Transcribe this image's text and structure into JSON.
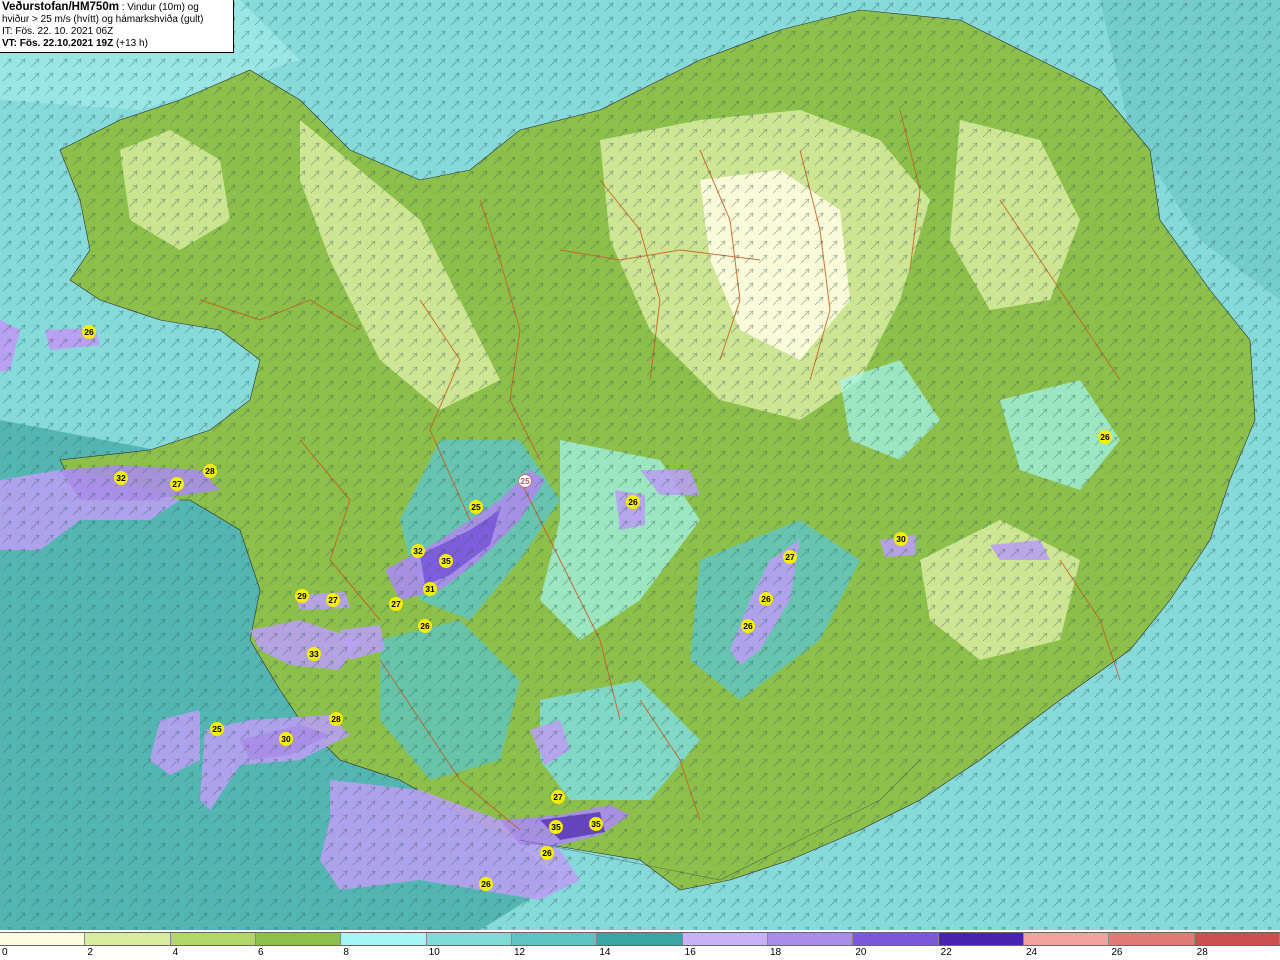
{
  "header": {
    "title": "Veðurstofan/HM750m",
    "desc_1": " : Vindur (10m) og",
    "desc_2": "hviður > 25 m/s (hvítt) og hámarkshviða (gult)",
    "issue_time": "IT: Fös. 22. 10. 2021 06Z",
    "valid_time_label": "VT: Fös. 22.10.2021 19Z",
    "valid_time_offset": " (+13 h)"
  },
  "legend": {
    "colors": [
      "#fffde0",
      "#d9eca0",
      "#b3d66b",
      "#8dc04a",
      "#a2f7f5",
      "#7fdcd9",
      "#5fc4c1",
      "#3aa5a3",
      "#c7b2f5",
      "#a98de8",
      "#7a58d8",
      "#4a22b0",
      "#f4a1a0",
      "#e07b78",
      "#c9504d"
    ],
    "ticks": [
      "0",
      "2",
      "4",
      "6",
      "8",
      "10",
      "12",
      "14",
      "16",
      "18",
      "20",
      "22",
      "24",
      "26",
      "28"
    ]
  },
  "gust_labels": [
    "26",
    "32",
    "27",
    "28",
    "25",
    "25",
    "32",
    "35",
    "31",
    "27",
    "29",
    "27",
    "26",
    "33",
    "25",
    "30",
    "28",
    "27",
    "35",
    "35",
    "26",
    "26",
    "26",
    "27",
    "26",
    "26",
    "30",
    "26"
  ],
  "colors": {
    "sea_light": "#7fd6d6",
    "sea_dark": "#3a9f9d",
    "land_green": "#8dc04a",
    "land_light": "#d9eca0",
    "highland": "#fffde0",
    "strong_wind": "#b9a0f2",
    "contour_brown": "#c85a1e",
    "gust_yellow": "#f5f000"
  }
}
